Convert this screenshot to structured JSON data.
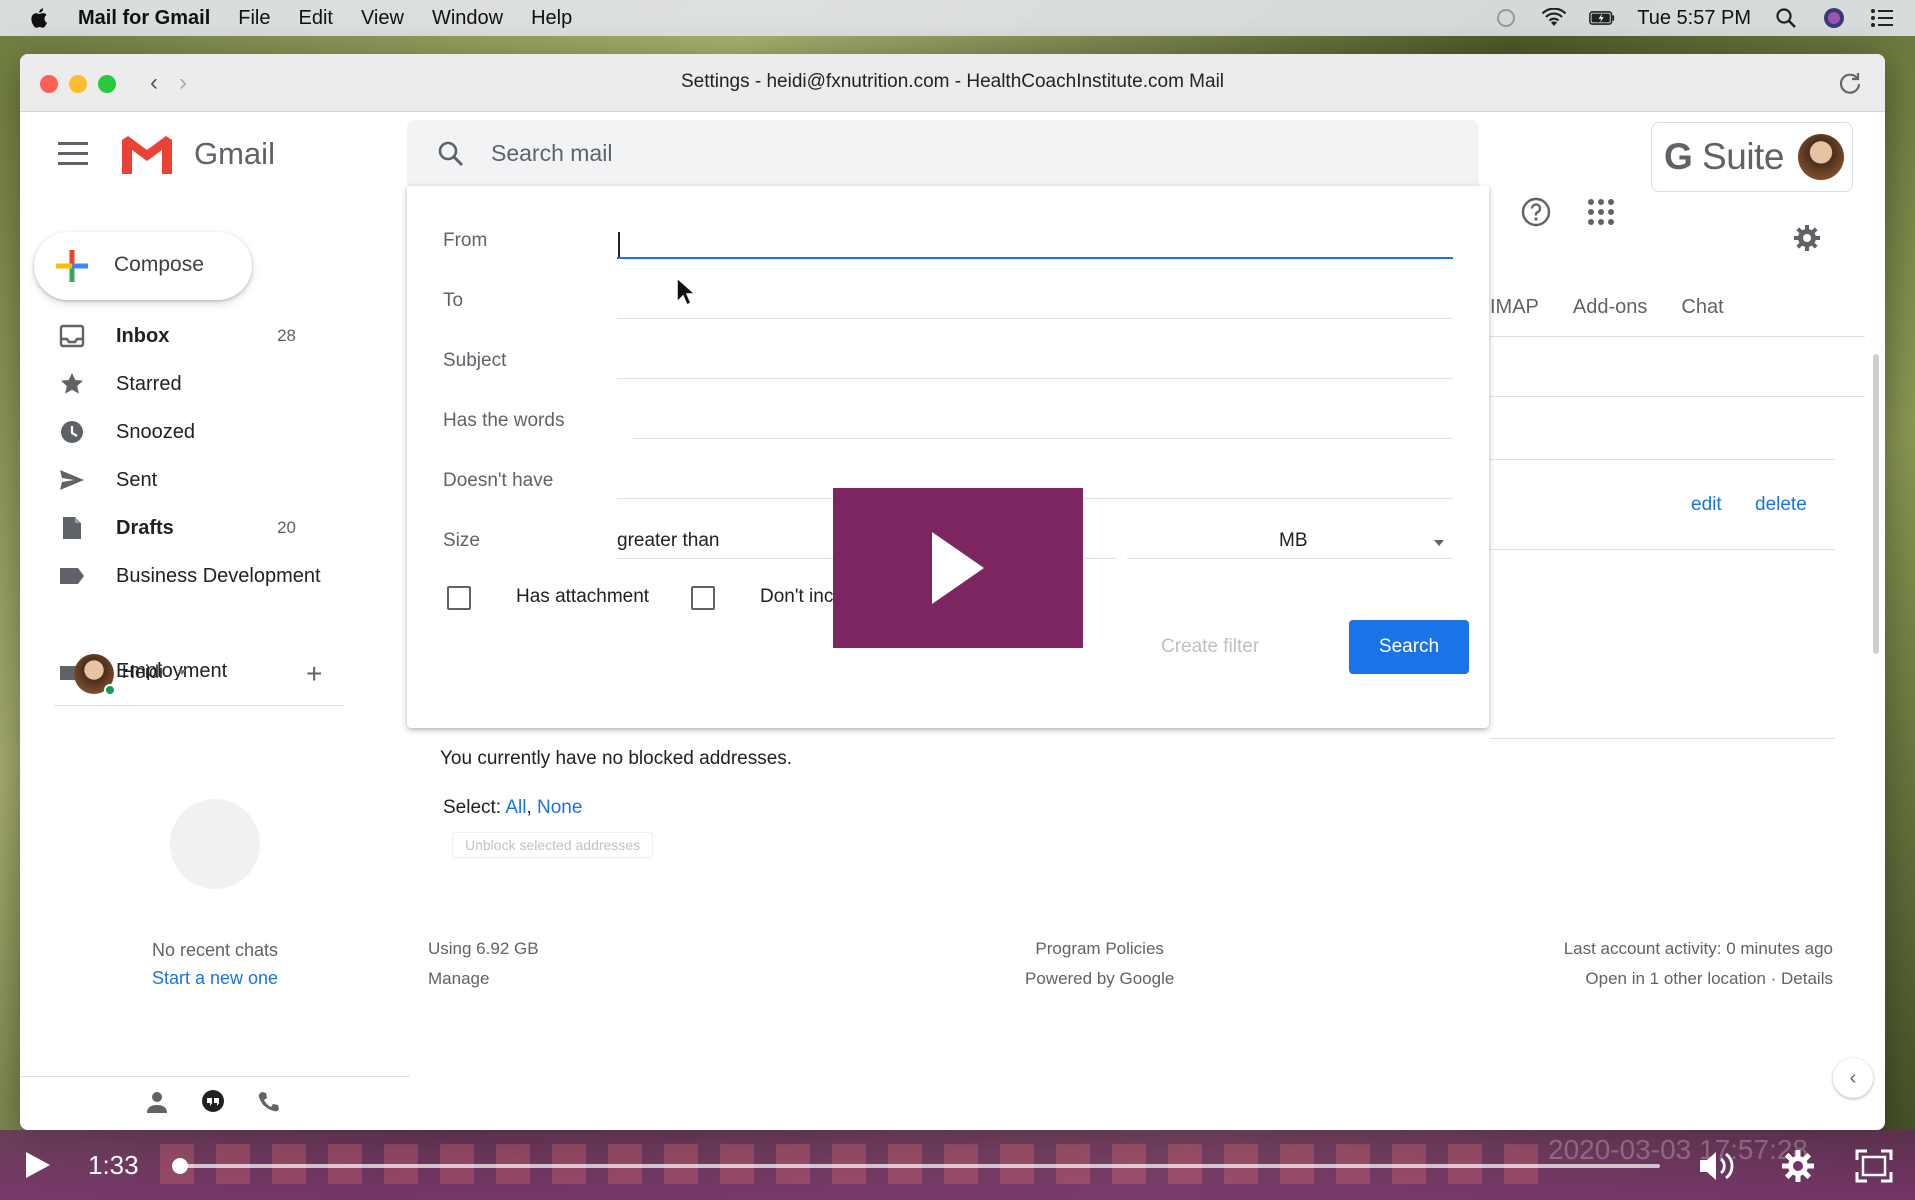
{
  "menubar": {
    "app_name": "Mail for Gmail",
    "menus": [
      "File",
      "Edit",
      "View",
      "Window",
      "Help"
    ],
    "clock": "Tue 5:57 PM"
  },
  "window": {
    "title": "Settings - heidi@fxnutrition.com - HealthCoachInstitute.com Mail"
  },
  "header": {
    "logo_text": "Gmail",
    "search_placeholder": "Search mail",
    "gsuite_g": "G",
    "gsuite_suite": " Suite"
  },
  "sidebar": {
    "compose_label": "Compose",
    "items": [
      {
        "label": "Inbox",
        "count": "28",
        "icon": "inbox-icon",
        "bold": true
      },
      {
        "label": "Starred",
        "count": "",
        "icon": "star-icon",
        "bold": false
      },
      {
        "label": "Snoozed",
        "count": "",
        "icon": "clock-icon",
        "bold": false
      },
      {
        "label": "Sent",
        "count": "",
        "icon": "send-icon",
        "bold": false
      },
      {
        "label": "Drafts",
        "count": "20",
        "icon": "draft-icon",
        "bold": true
      },
      {
        "label": "Business Development",
        "count": "",
        "icon": "label-icon",
        "bold": false
      }
    ],
    "partial_item": "Employment"
  },
  "hangouts": {
    "user_name": "Heidi",
    "no_chats": "No recent chats",
    "start_new": "Start a new one"
  },
  "settings": {
    "tabs_partial": [
      "IMAP",
      "Add-ons",
      "Chat"
    ],
    "edit": "edit",
    "delete": "delete",
    "blocked_text": "You currently have no blocked addresses.",
    "select_prefix": "Select: ",
    "select_all": "All",
    "select_sep": ", ",
    "select_none": "None",
    "unblock_button": "Unblock selected addresses",
    "footer": {
      "usage": "Using 6.92 GB",
      "manage": "Manage",
      "policies": "Program Policies",
      "powered": "Powered by Google",
      "activity": "Last account activity: 0 minutes ago",
      "locations": "Open in 1 other location · Details"
    }
  },
  "advanced_search": {
    "labels": {
      "from": "From",
      "to": "To",
      "subject": "Subject",
      "has_words": "Has the words",
      "doesnt_have": "Doesn't have",
      "size": "Size"
    },
    "values": {
      "from": "",
      "to": "",
      "subject": "",
      "has_words": "",
      "doesnt_have": ""
    },
    "size_operator": "greater than",
    "size_unit": "MB",
    "has_attachment_label": "Has attachment",
    "dont_include_label": "Don't inclu",
    "create_filter": "Create filter",
    "search_button": "Search"
  },
  "video": {
    "elapsed": "1:33",
    "watermark": "2020-03-03 17:57:28",
    "progress": 0.004
  },
  "colors": {
    "accent": "#1a73e8",
    "video_overlay": "#7d2561",
    "gmail_red": "#ea4335"
  }
}
